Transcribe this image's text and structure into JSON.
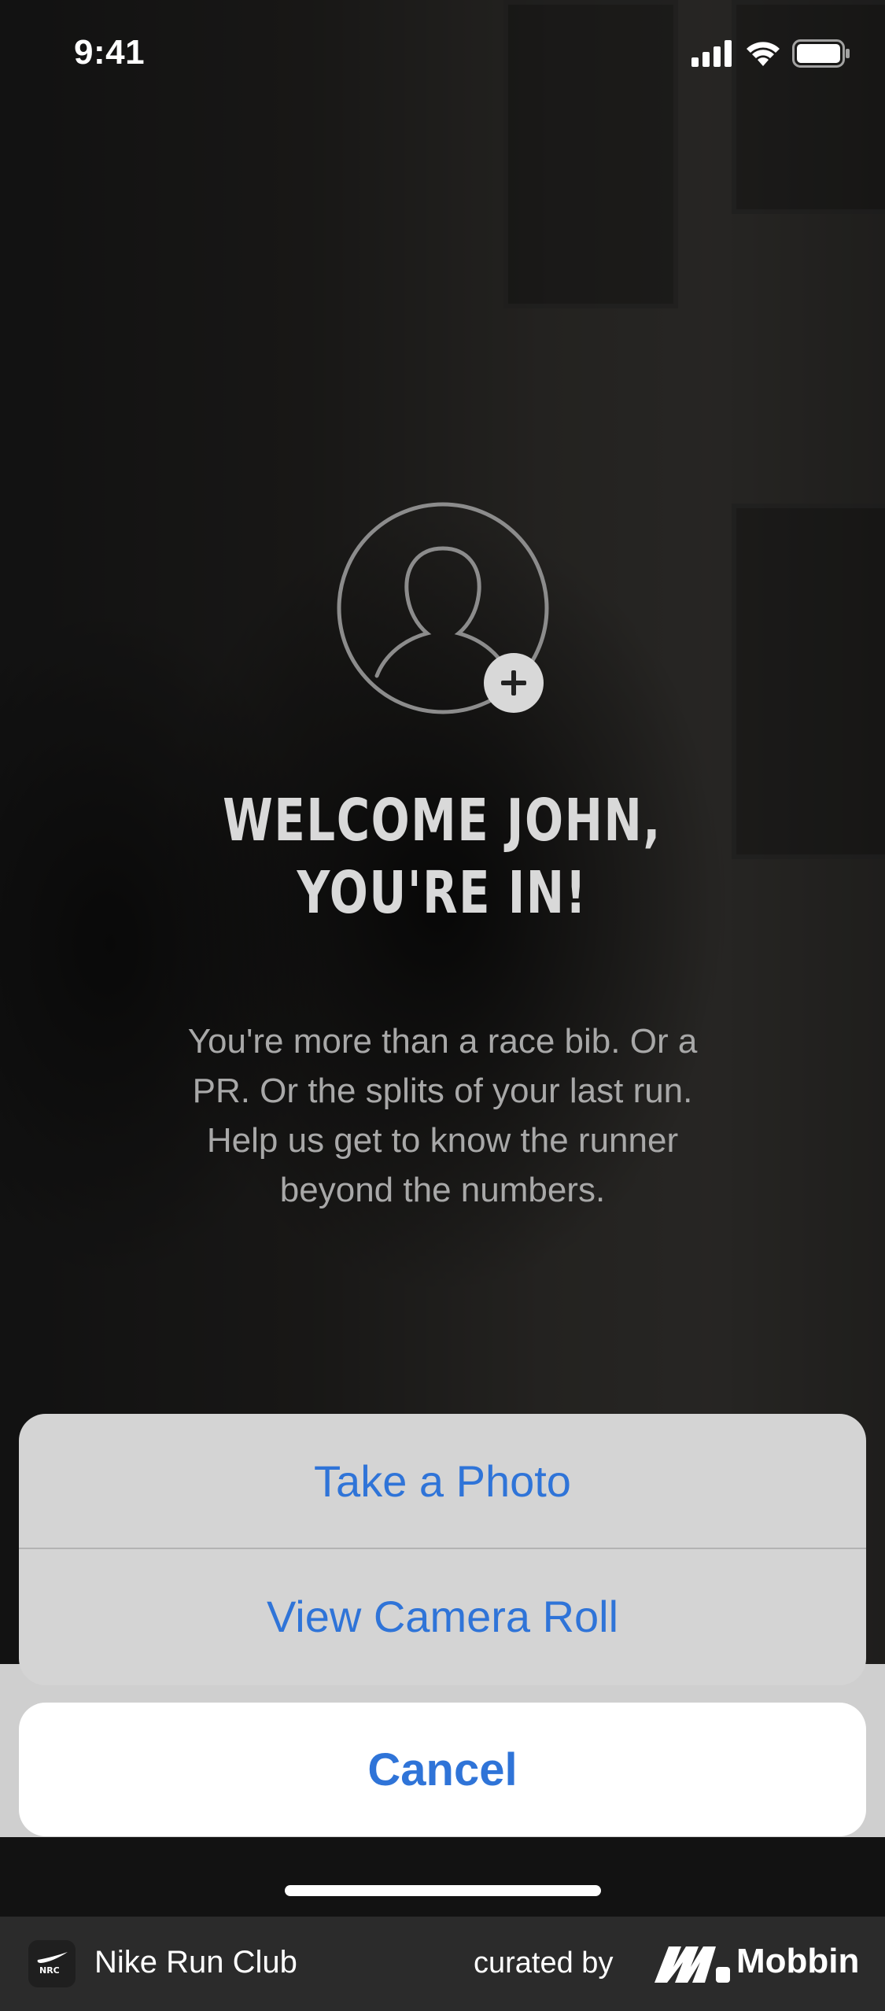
{
  "status_bar": {
    "time": "9:41",
    "icons": [
      "signal-icon",
      "wifi-icon",
      "battery-icon"
    ]
  },
  "profile": {
    "avatar_icon": "person-icon",
    "add_icon": "plus-icon"
  },
  "welcome": {
    "title_line1": "WELCOME JOHN,",
    "title_line2": "YOU'RE IN!",
    "body": "You're more than a race bib. Or a PR. Or the splits of your last run. Help us get to know the runner beyond the numbers."
  },
  "action_sheet": {
    "take_photo": "Take a Photo",
    "camera_roll": "View Camera Roll",
    "cancel": "Cancel"
  },
  "footer": {
    "app_name": "Nike Run Club",
    "curated_by": "curated by",
    "brand": "Mobbin"
  },
  "colors": {
    "action_blue": "#2f74d8",
    "sheet_gray": "#d4d4d4",
    "footer_bg": "#2b2b2b"
  }
}
